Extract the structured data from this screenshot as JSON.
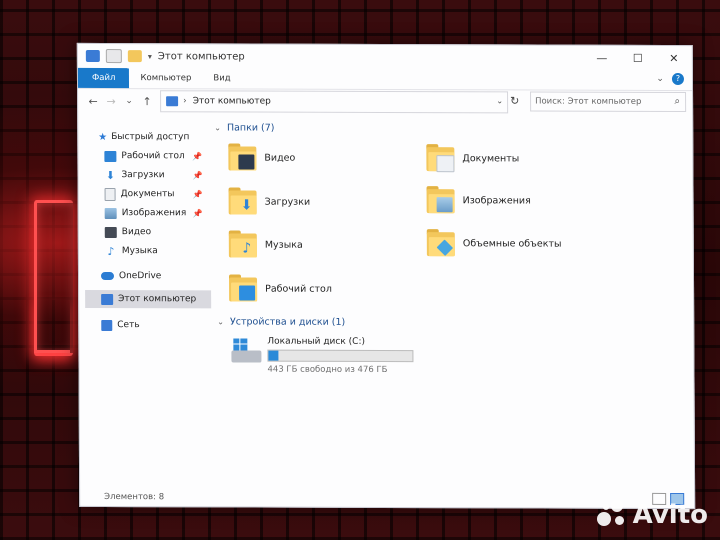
{
  "window": {
    "title": "Этот компьютер",
    "controls": [
      "—",
      "☐",
      "✕"
    ]
  },
  "ribbon": {
    "tabs": [
      "Файл",
      "Компьютер",
      "Вид"
    ],
    "expand_icon": "chevron-down-icon",
    "help_icon": "help-icon",
    "help_glyph": "?"
  },
  "nav": {
    "back": "←",
    "forward": "→",
    "recent": "⌄",
    "up": "↑",
    "refresh": "↻",
    "path_separator": "›",
    "path": "Этот компьютер",
    "search_placeholder": "Поиск: Этот компьютер",
    "search_glyph": "⌕"
  },
  "sidebar": {
    "items": [
      {
        "label": "Быстрый доступ",
        "icon": "star-icon",
        "color": "#2c7ad6"
      },
      {
        "label": "Рабочий стол",
        "icon": "desktop-icon",
        "color": "#2d83d6",
        "pinned": true
      },
      {
        "label": "Загрузки",
        "icon": "download-icon",
        "color": "#2d83d6",
        "pinned": true
      },
      {
        "label": "Документы",
        "icon": "document-icon",
        "color": "#9aa3ad",
        "pinned": true
      },
      {
        "label": "Изображения",
        "icon": "picture-icon",
        "color": "#5f8fba",
        "pinned": true
      },
      {
        "label": "Видео",
        "icon": "video-icon",
        "color": "#444a55"
      },
      {
        "label": "Музыка",
        "icon": "music-icon",
        "color": "#2d83d6"
      },
      {
        "label": "OneDrive",
        "icon": "cloud-icon",
        "color": "#2b7cd3"
      },
      {
        "label": "Этот компьютер",
        "icon": "computer-icon",
        "color": "#3a7bd5",
        "selected": true
      },
      {
        "label": "Сеть",
        "icon": "network-icon",
        "color": "#3a7bd5"
      }
    ],
    "pin_glyph": "📌"
  },
  "folders_group": {
    "title": "Папки (7)",
    "items": [
      {
        "label": "Видео",
        "badge_color": "#2d3a4d",
        "icon": "video-folder-icon"
      },
      {
        "label": "Документы",
        "badge_color": "#eef1f5",
        "icon": "documents-folder-icon"
      },
      {
        "label": "Загрузки",
        "badge_color": "#2d83d6",
        "icon": "downloads-folder-icon"
      },
      {
        "label": "Изображения",
        "badge_color": "#6a9cc8",
        "icon": "pictures-folder-icon"
      },
      {
        "label": "Музыка",
        "badge_color": "#2d83d6",
        "icon": "music-folder-icon"
      },
      {
        "label": "Объемные объекты",
        "badge_color": "#47a6e0",
        "icon": "3d-objects-folder-icon"
      },
      {
        "label": "Рабочий стол",
        "badge_color": "#2d8ee0",
        "icon": "desktop-folder-icon"
      }
    ]
  },
  "drives_group": {
    "title": "Устройства и диски (1)",
    "drive": {
      "name": "Локальный диск (C:)",
      "free_text": "443 ГБ свободно из 476 ГБ",
      "used_fraction": 0.07,
      "icon": "hard-drive-icon"
    }
  },
  "status": {
    "count": "Элементов: 8"
  },
  "watermark": {
    "brand": "Avito"
  }
}
